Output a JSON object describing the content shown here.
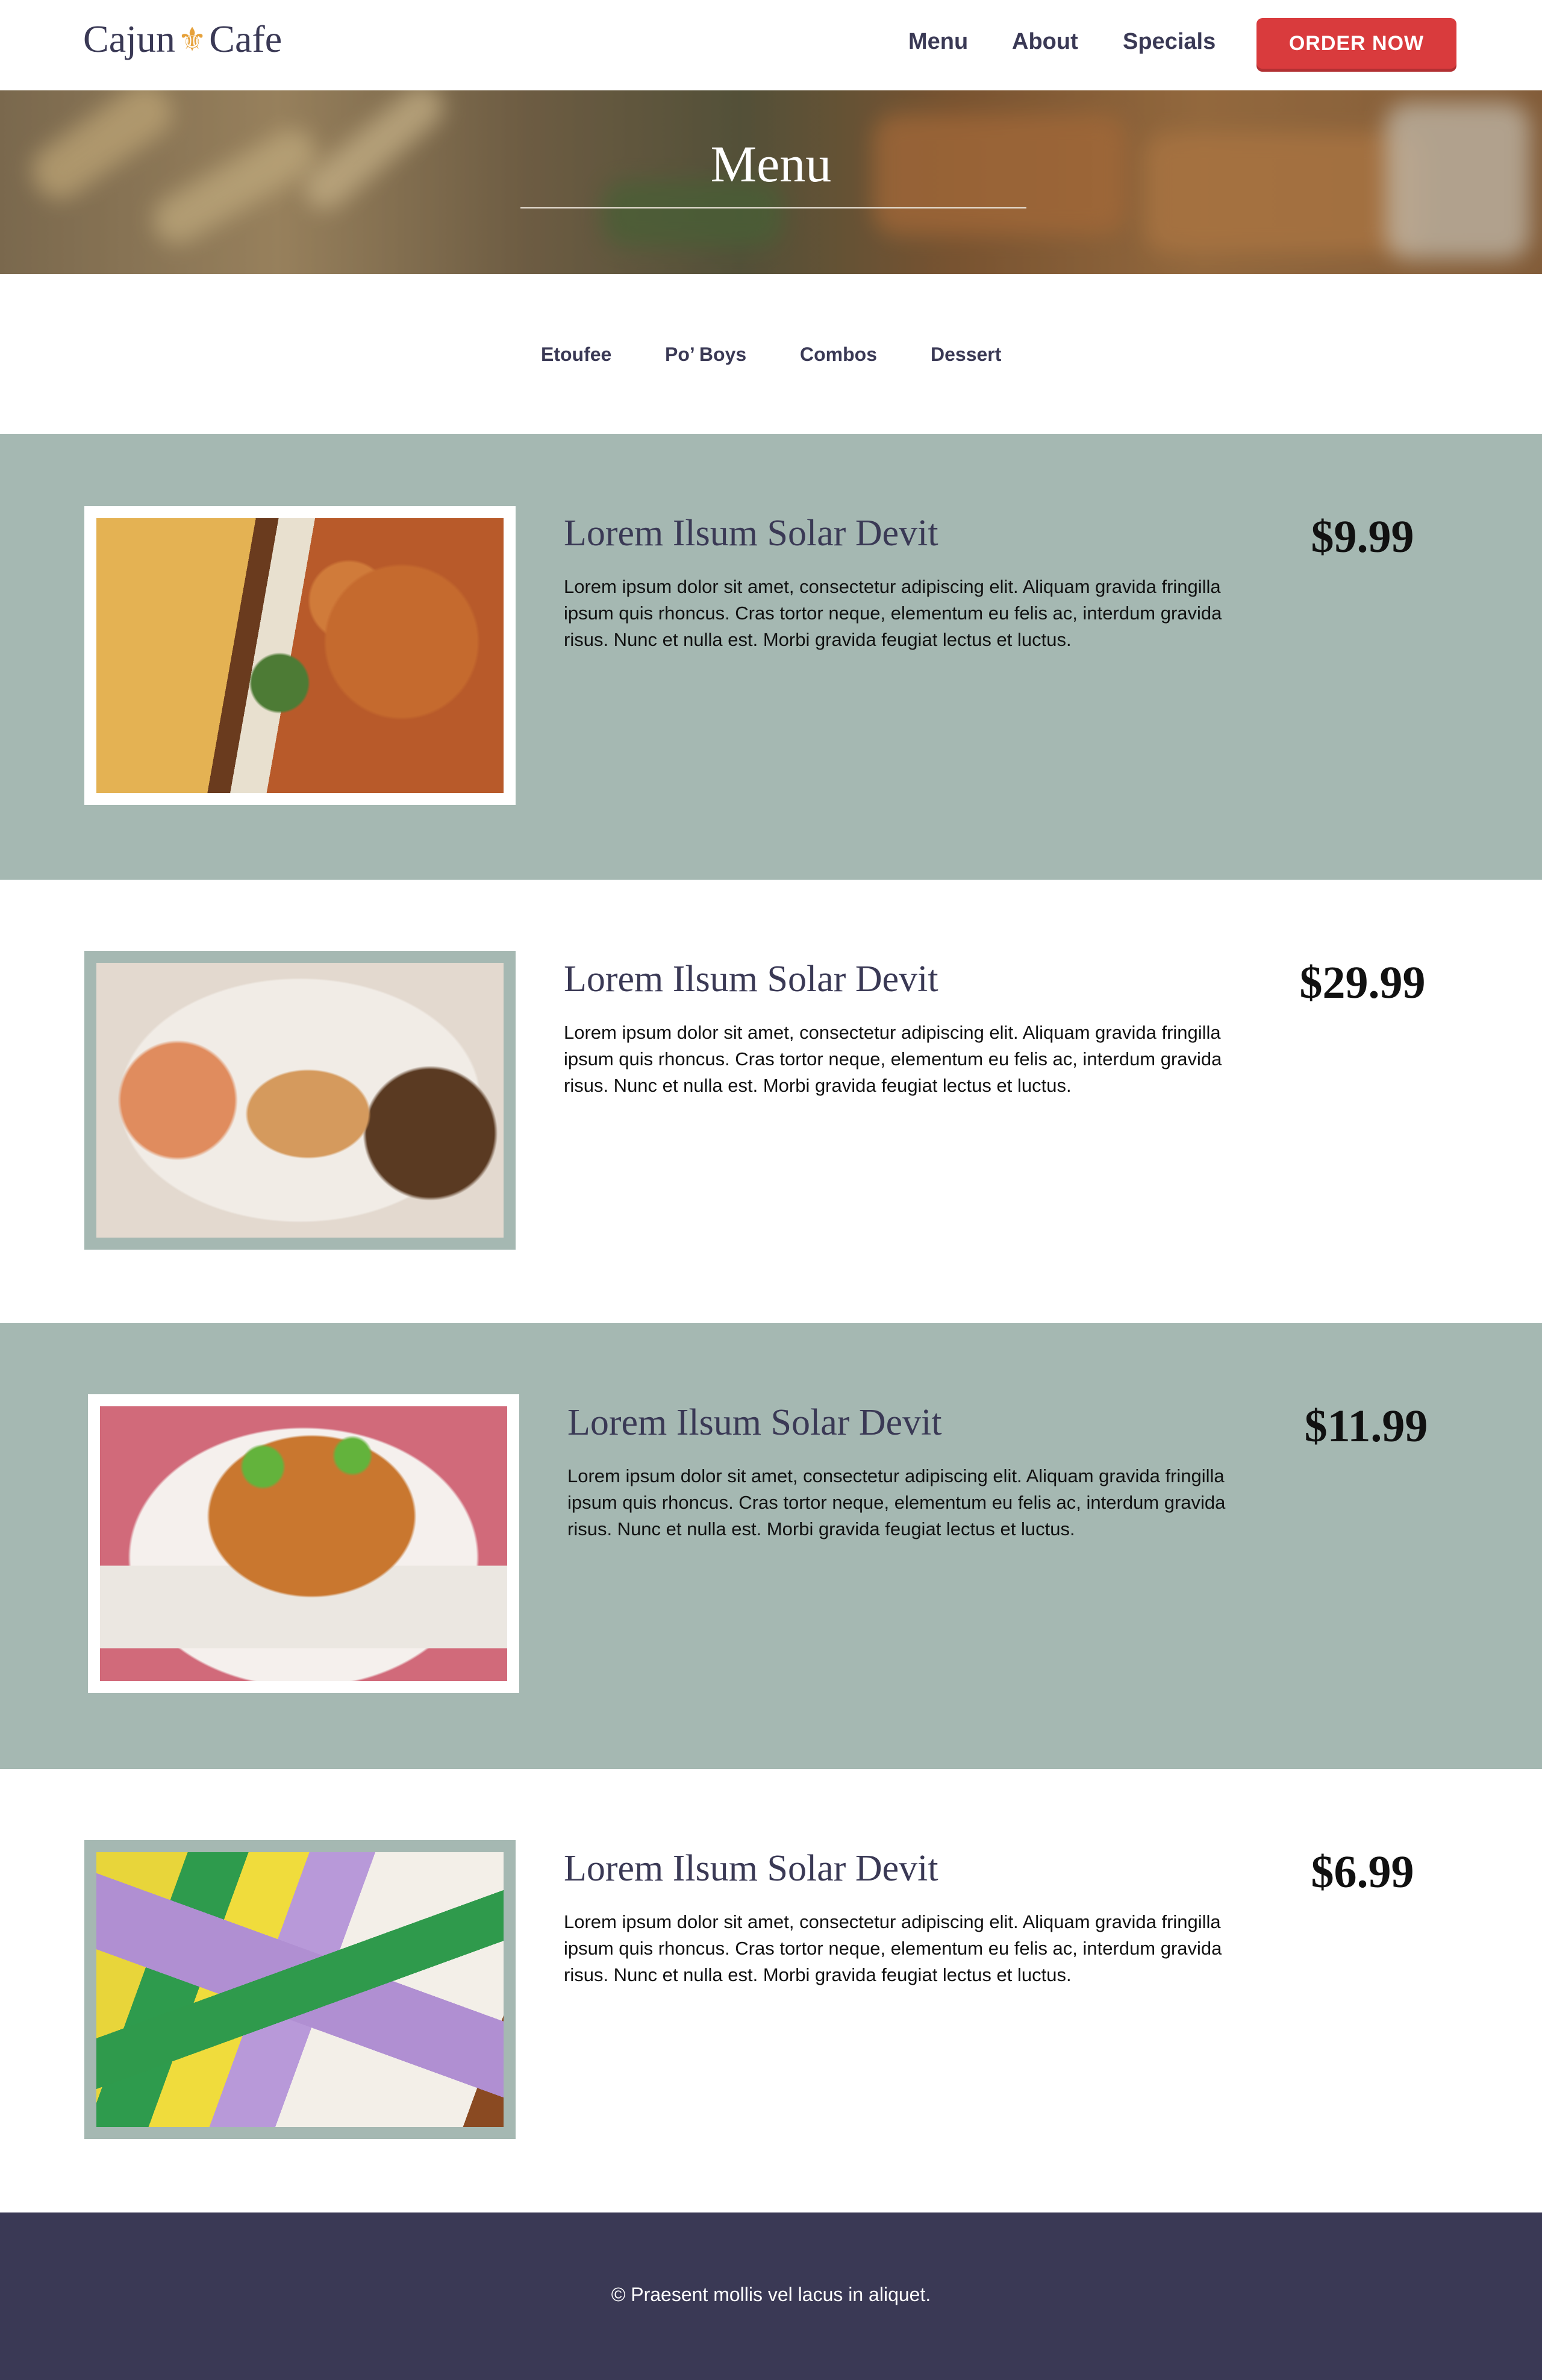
{
  "header": {
    "logo": {
      "left": "Cajun",
      "right": "Cafe",
      "emblem": "fleur-de-lis-icon"
    },
    "nav": [
      "Menu",
      "About",
      "Specials"
    ],
    "order_button": "ORDER NOW"
  },
  "hero": {
    "title": "Menu"
  },
  "tabs": [
    "Etoufee",
    "Po’ Boys",
    "Combos",
    "Dessert"
  ],
  "items": [
    {
      "title": "Lorem Ilsum Solar Devit",
      "description": "Lorem ipsum dolor sit amet, consectetur adipiscing elit. Aliquam gravida fringilla ipsum quis rhoncus. Cras tortor neque, elementum eu felis ac, interdum gravida risus. Nunc et nulla est. Morbi gravida feugiat lectus et luctus.",
      "price": "$9.99",
      "image": "shrimp-po-boy-photo"
    },
    {
      "title": "Lorem Ilsum Solar Devit",
      "description": "Lorem ipsum dolor sit amet, consectetur adipiscing elit. Aliquam gravida fringilla ipsum quis rhoncus. Cras tortor neque, elementum eu felis ac, interdum gravida risus. Nunc et nulla est. Morbi gravida feugiat lectus et luctus.",
      "price": "$29.99",
      "image": "seafood-combo-photo"
    },
    {
      "title": "Lorem Ilsum Solar Devit",
      "description": "Lorem ipsum dolor sit amet, consectetur adipiscing elit. Aliquam gravida fringilla ipsum quis rhoncus. Cras tortor neque, elementum eu felis ac, interdum gravida risus. Nunc et nulla est. Morbi gravida feugiat lectus et luctus.",
      "price": "$11.99",
      "image": "crawfish-etouffee-photo"
    },
    {
      "title": "Lorem Ilsum Solar Devit",
      "description": "Lorem ipsum dolor sit amet, consectetur adipiscing elit. Aliquam gravida fringilla ipsum quis rhoncus. Cras tortor neque, elementum eu felis ac, interdum gravida risus. Nunc et nulla est. Morbi gravida feugiat lectus et luctus.",
      "price": "$6.99",
      "image": "king-cake-photo"
    }
  ],
  "footer": {
    "text": "© Praesent mollis vel lacus in aliquet."
  },
  "colors": {
    "brand_navy": "#3a3955",
    "sage": "#a5b8b2",
    "order_red": "#d93b3d",
    "gold": "#e6a13a"
  }
}
